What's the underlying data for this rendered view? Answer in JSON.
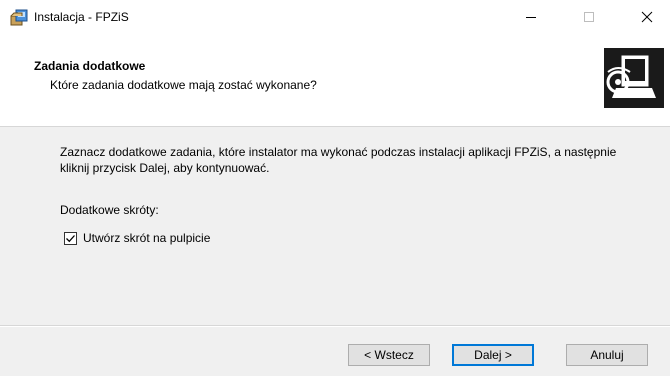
{
  "window": {
    "title": "Instalacja - FPZiS"
  },
  "header": {
    "title": "Zadania dodatkowe",
    "subtitle": "Które zadania dodatkowe mają zostać wykonane?"
  },
  "content": {
    "description": "Zaznacz dodatkowe zadania, które instalator ma wykonać podczas instalacji aplikacji FPZiS, a następnie kliknij przycisk Dalej, aby kontynuować.",
    "section_label": "Dodatkowe skróty:",
    "tasks": [
      {
        "label": "Utwórz skrót na pulpicie",
        "checked": true
      }
    ]
  },
  "buttons": {
    "back": "< Wstecz",
    "next": "Dalej >",
    "cancel": "Anuluj"
  },
  "colors": {
    "accent": "#0078d7",
    "window_bg": "#f0f0f0",
    "header_bg": "#ffffff"
  },
  "icons": {
    "app": "installer-box-icon",
    "wizard": "computer-cd-icon"
  }
}
